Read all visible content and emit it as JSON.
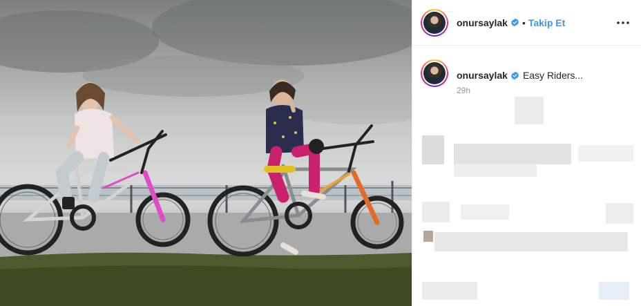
{
  "post": {
    "username": "onursaylak",
    "follow_label": "Takip Et",
    "separator": "•",
    "caption_text": "Easy Riders...",
    "timestamp": "29h"
  },
  "colors": {
    "follow": "#3897f0",
    "verified": "#3897f0",
    "text": "#262626",
    "muted": "#999999"
  },
  "icons": [
    "verified-badge-icon",
    "more-options-icon"
  ]
}
